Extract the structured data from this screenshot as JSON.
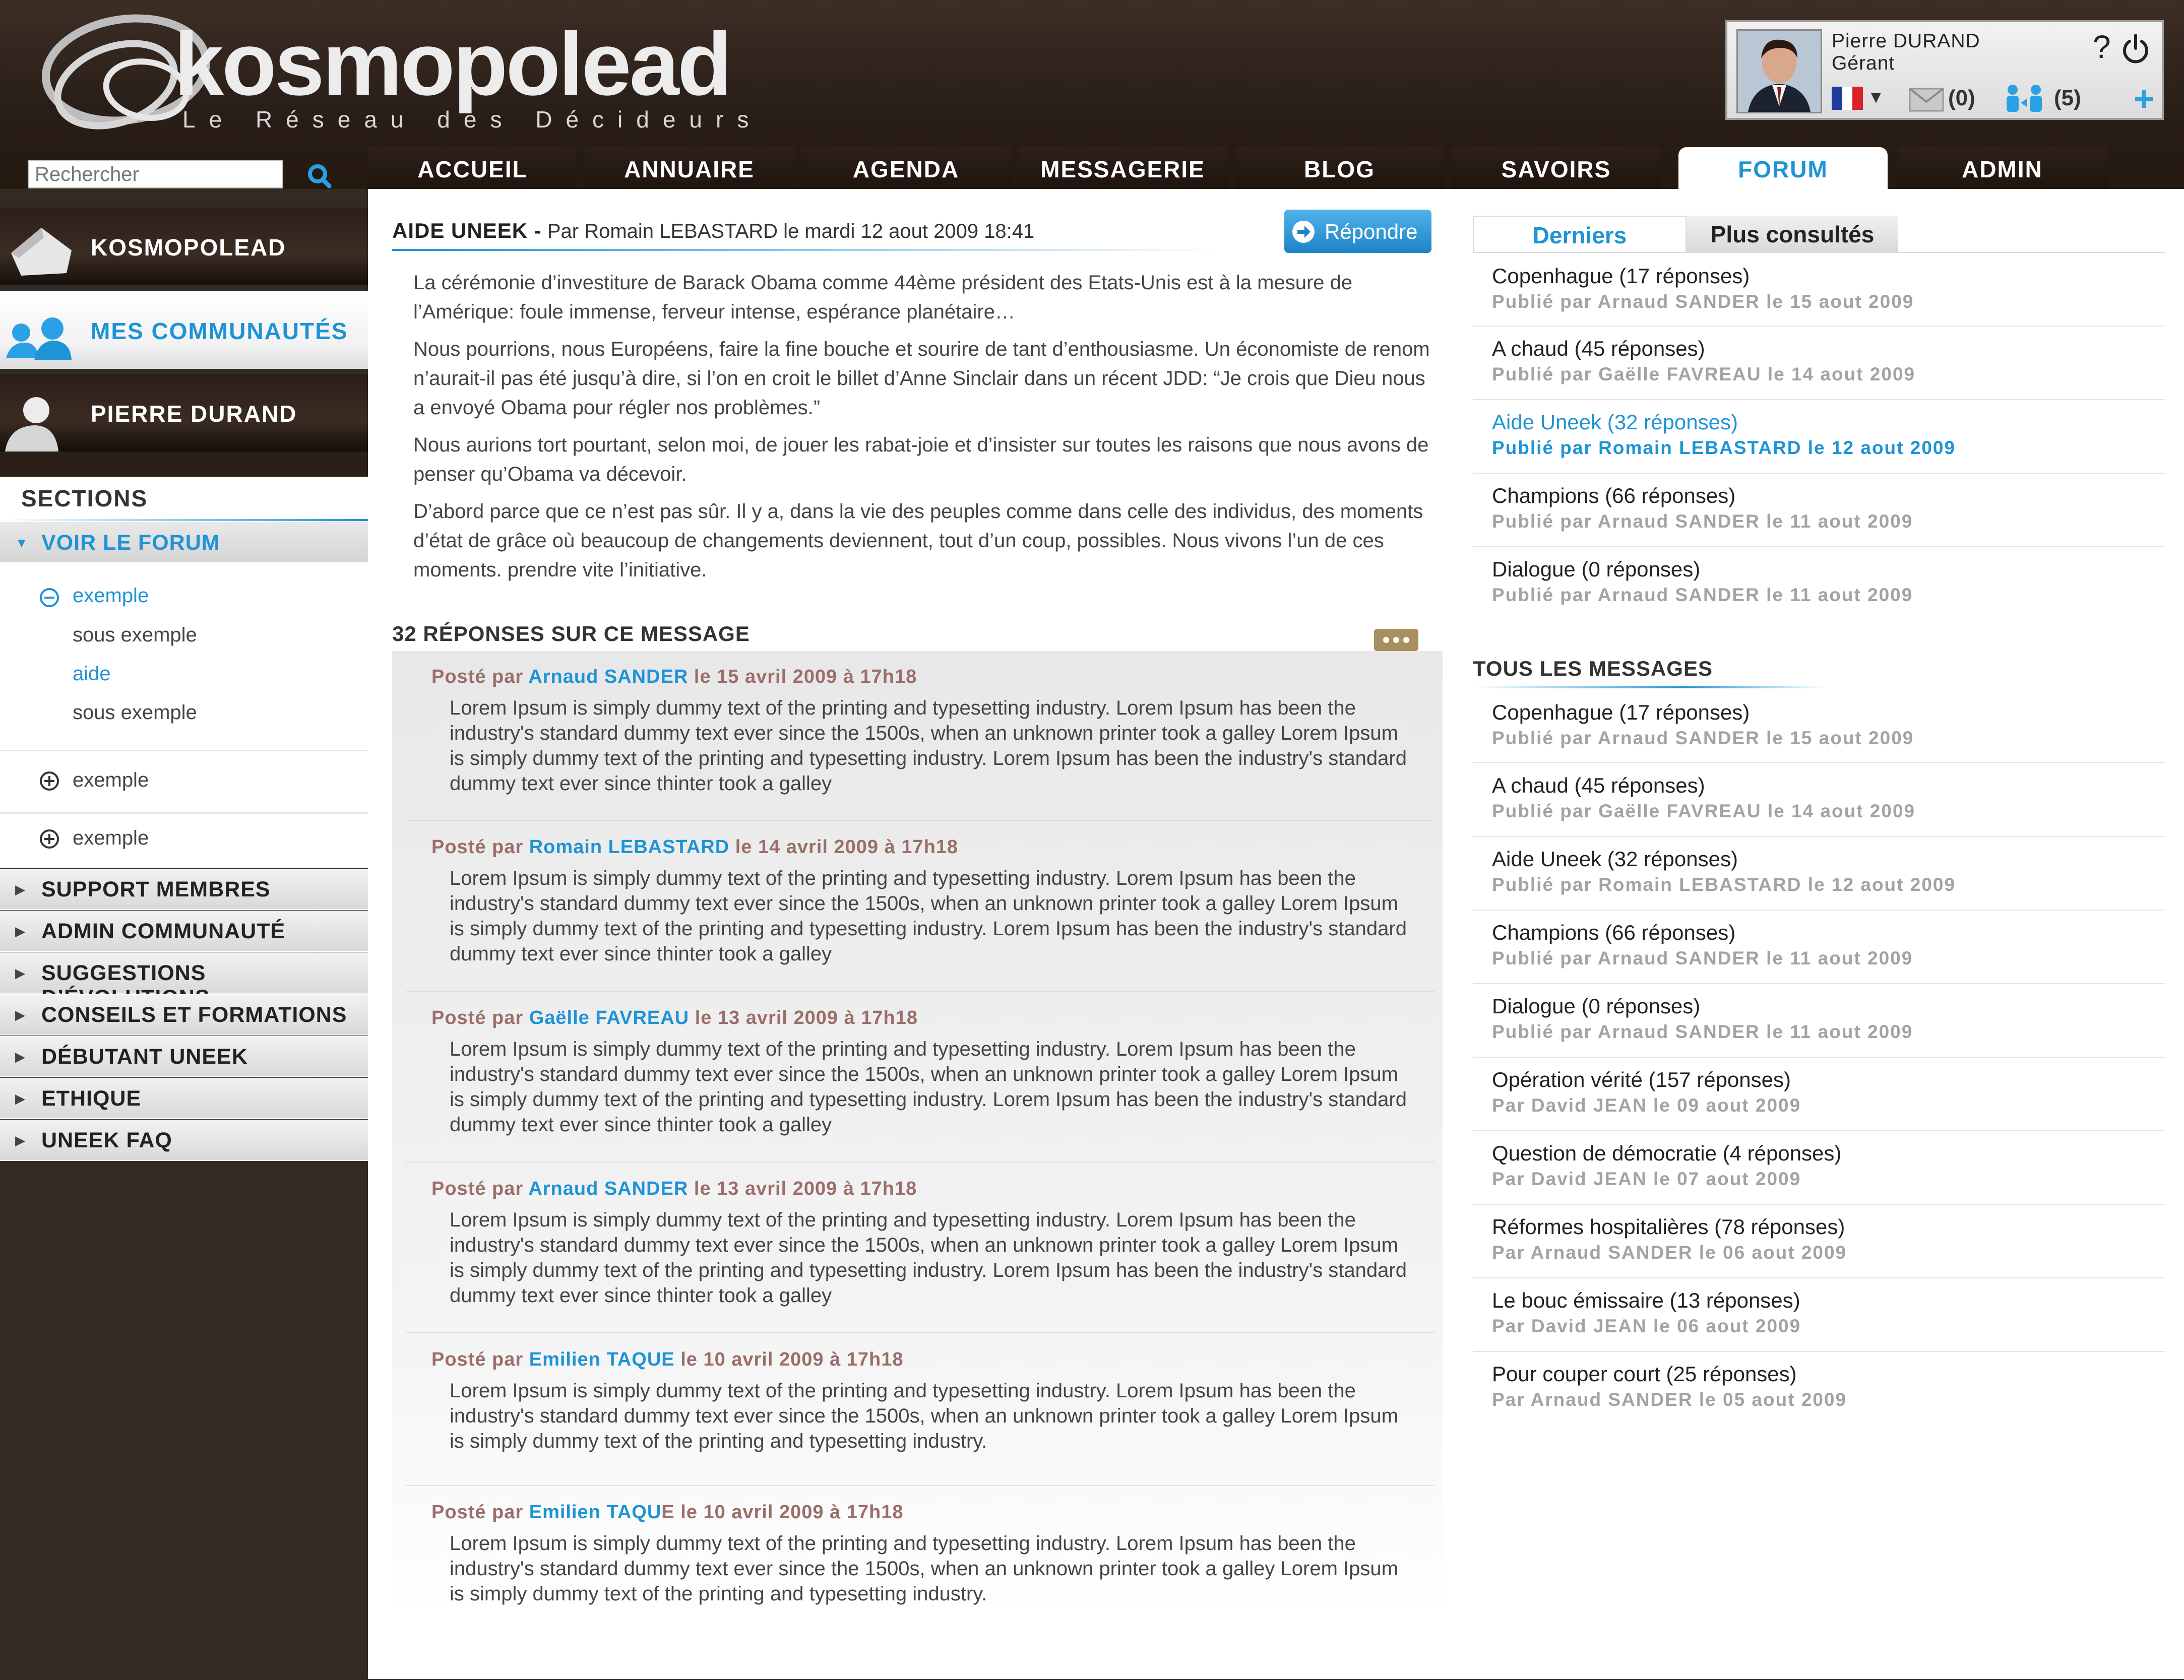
{
  "brand": {
    "name": "kosmopolead",
    "tagline": "Le Réseau des Décideurs"
  },
  "search": {
    "placeholder": "Rechercher"
  },
  "nav": [
    "ACCUEIL",
    "ANNUAIRE",
    "AGENDA",
    "MESSAGERIE",
    "BLOG",
    "SAVOIRS",
    "FORUM",
    "ADMIN"
  ],
  "nav_active": "FORUM",
  "user": {
    "name": "Pierre DURAND",
    "role": "Gérant",
    "help": "?",
    "messages_count": "(0)",
    "contacts_count": "(5)",
    "add": "+",
    "lang_caret": "▼"
  },
  "sidebar": {
    "banners": [
      "KOSMOPOLEAD",
      "MES COMMUNAUTÉS",
      "PIERRE DURAND"
    ],
    "sections_title": "SECTIONS",
    "active_section": "VOIR LE FORUM",
    "tree": [
      "exemple",
      "sous exemple",
      "aide",
      "sous exemple"
    ],
    "collapsed": [
      "exemple",
      "exemple"
    ],
    "sections": [
      "SUPPORT MEMBRES",
      "ADMIN COMMUNAUTÉ",
      "SUGGESTIONS D’ÉVOLUTIONS",
      "CONSEILS ET FORMATIONS",
      "DÉBUTANT UNEEK",
      "ETHIQUE",
      "UNEEK FAQ"
    ]
  },
  "post": {
    "title": "AIDE UNEEK -",
    "byline": "Par Romain LEBASTARD le mardi 12 aout 2009 18:41",
    "reply_label": "Répondre",
    "paragraphs": [
      "La cérémonie d’investiture de Barack Obama comme 44ème président des Etats-Unis est à la mesure de l’Amérique: foule immense, ferveur intense, espérance planétaire…",
      "Nous pourrions, nous Européens, faire la fine bouche et sourire de tant d’enthousiasme. Un économiste de renom n’aurait-il pas été jusqu’à dire, si l’on en croit le billet d’Anne Sinclair dans un récent JDD: “Je crois que Dieu nous a envoyé Obama pour régler nos problèmes.”",
      "Nous aurions tort pourtant, selon moi, de jouer les rabat-joie et d’insister sur toutes les raisons que nous avons de penser qu’Obama va décevoir.",
      "D’abord parce que ce n’est pas sûr. Il y a, dans la vie des peuples comme dans celle des individus, des moments d’état de grâce où beaucoup de changements deviennent, tout d’un coup, possibles. Nous vivons l’un de ces moments. prendre vite l’initiative."
    ]
  },
  "replies": {
    "title": "32 RÉPONSES SUR CE MESSAGE",
    "items": [
      {
        "prefix": "Posté par",
        "name": "Arnaud SANDER",
        "date": "le 15 avril 2009 à 17h18",
        "text": "Lorem Ipsum is simply dummy text of the printing and typesetting industry. Lorem Ipsum has been the industry's standard dummy text ever since the 1500s, when an unknown printer took a galley Lorem Ipsum is simply dummy text of the printing and typesetting industry. Lorem Ipsum has been the industry's standard dummy text ever since thinter took a galley"
      },
      {
        "prefix": "Posté par",
        "name": "Romain LEBASTARD",
        "date": "le 14 avril 2009 à 17h18",
        "text": "Lorem Ipsum is simply dummy text of the printing and typesetting industry. Lorem Ipsum has been the industry's standard dummy text ever since the 1500s, when an unknown printer took a galley Lorem Ipsum is simply dummy text of the printing and typesetting industry. Lorem Ipsum has been the industry's standard dummy text ever since thinter took a galley"
      },
      {
        "prefix": "Posté par",
        "name": "Gaëlle FAVREAU",
        "date": "le 13 avril 2009 à 17h18",
        "text": "Lorem Ipsum is simply dummy text of the printing and typesetting industry. Lorem Ipsum has been the industry's standard dummy text ever since the 1500s, when an unknown printer took a galley Lorem Ipsum is simply dummy text of the printing and typesetting industry. Lorem Ipsum has been the industry's standard dummy text ever since thinter took a galley"
      },
      {
        "prefix": "Posté par",
        "name": "Arnaud SANDER",
        "date": "le 13 avril 2009 à 17h18",
        "text": "Lorem Ipsum is simply dummy text of the printing and typesetting industry. Lorem Ipsum has been the industry's standard dummy text ever since the 1500s, when an unknown printer took a galley Lorem Ipsum is simply dummy text of the printing and typesetting industry. Lorem Ipsum has been the industry's standard dummy text ever since thinter took a galley"
      },
      {
        "prefix": "Posté par",
        "name": "Emilien TAQUE",
        "date": "le 10 avril 2009 à 17h18",
        "text": "Lorem Ipsum is simply dummy text of the printing and typesetting industry. Lorem Ipsum has been the industry's standard dummy text ever since the 1500s, when an unknown printer took a galley Lorem Ipsum is simply dummy text of the printing and typesetting industry."
      },
      {
        "prefix": "Posté par",
        "name": "Emilien TAQU",
        "name_suffix": "E",
        "date": "le 10 avril 2009 à 17h18",
        "text": "Lorem Ipsum is simply dummy text of the printing and typesetting industry. Lorem Ipsum has been the industry's standard dummy text ever since the 1500s, when an unknown printer took a galley Lorem Ipsum is simply dummy text of the printing and typesetting industry."
      }
    ]
  },
  "right": {
    "tabs": [
      "Derniers",
      "Plus consultés"
    ],
    "latest": [
      {
        "title": "Copenhague (17 réponses)",
        "sub": "Publié par Arnaud SANDER le 15 aout 2009"
      },
      {
        "title": "A chaud (45 réponses)",
        "sub": "Publié par Gaëlle FAVREAU le 14 aout 2009"
      },
      {
        "title": "Aide Uneek (32 réponses)",
        "sub": "Publié par Romain LEBASTARD le 12 aout 2009"
      },
      {
        "title": "Champions (66 réponses)",
        "sub": "Publié par Arnaud SANDER le 11 aout 2009"
      },
      {
        "title": "Dialogue (0 réponses)",
        "sub": "Publié par Arnaud SANDER le 11 aout 2009"
      }
    ],
    "all_title": "TOUS LES MESSAGES",
    "all": [
      {
        "title": "Copenhague (17 réponses)",
        "sub": "Publié par Arnaud SANDER le 15 aout 2009"
      },
      {
        "title": "A chaud (45 réponses)",
        "sub": "Publié par Gaëlle FAVREAU le 14 aout 2009"
      },
      {
        "title": "Aide Uneek (32 réponses)",
        "sub": "Publié par Romain LEBASTARD le 12 aout 2009"
      },
      {
        "title": "Champions (66 réponses)",
        "sub": "Publié par Arnaud SANDER le 11 aout 2009"
      },
      {
        "title": "Dialogue (0 réponses)",
        "sub": "Publié par Arnaud SANDER le 11 aout 2009"
      },
      {
        "title": "Opération vérité (157 réponses)",
        "sub": "Par David JEAN le 09 aout 2009"
      },
      {
        "title": "Question de démocratie (4 réponses)",
        "sub": "Par David JEAN le 07 aout 2009"
      },
      {
        "title": "Réformes hospitalières (78 réponses)",
        "sub": "Par Arnaud SANDER le 06 aout 2009"
      },
      {
        "title": "Le bouc émissaire (13 réponses)",
        "sub": "Par David JEAN le 06 aout 2009"
      },
      {
        "title": "Pour couper court (25 réponses)",
        "sub": "Par Arnaud SANDER le 05 aout 2009"
      }
    ]
  },
  "colors": {
    "accent": "#1e93d6",
    "header": "#2a1f19",
    "sidebar": "#332a23",
    "meta": "#9b6e6a"
  }
}
